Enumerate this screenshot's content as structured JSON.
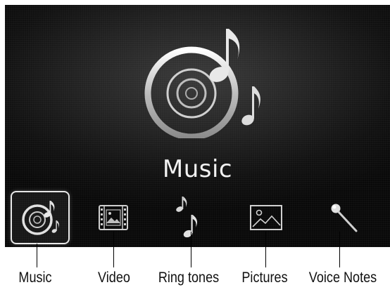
{
  "screen": {
    "selected_title": "Music",
    "selected_index": 0
  },
  "categories": [
    {
      "label": "Music",
      "icon": "music-disc-icon"
    },
    {
      "label": "Video",
      "icon": "film-frame-icon"
    },
    {
      "label": "Ring tones",
      "icon": "music-note-icon"
    },
    {
      "label": "Pictures",
      "icon": "picture-icon"
    },
    {
      "label": "Voice Notes",
      "icon": "microphone-icon"
    }
  ],
  "callouts": [
    "Music",
    "Video",
    "Ring tones",
    "Pictures",
    "Voice Notes"
  ],
  "colors": {
    "screen_background": "#1a1a1a",
    "icon": "#d9d9d9",
    "text": "#f2f2f2",
    "callout_text": "#111111"
  }
}
